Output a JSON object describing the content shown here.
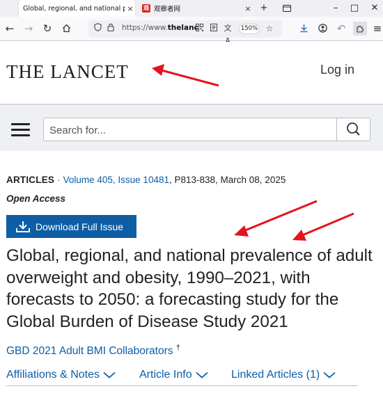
{
  "browser": {
    "tabs": [
      {
        "title": "Global, regional, and national pre",
        "active": true
      },
      {
        "title": "观察者网",
        "favicon": "观",
        "active": false
      }
    ],
    "controls": {
      "close_tab": "×",
      "new_tab": "+",
      "tab_list": "▭",
      "minimize": "–",
      "maximize": "□",
      "close_window": "✕"
    },
    "url": "https://www.thelancet",
    "url_bold_part": "thelanc",
    "url_prefix": "https://www.",
    "zoom": "150%"
  },
  "site": {
    "logo": "THE LANCET",
    "login": "Log in",
    "search_placeholder": "Search for..."
  },
  "article": {
    "type": "ARTICLES",
    "separator": "·",
    "volume_issue": "Volume 405, Issue 10481",
    "pages_date": ", P813-838, March 08, 2025",
    "access": "Open Access",
    "download_label": "Download Full Issue",
    "title": "Global, regional, and national prevalence of adult overweight and obesity, 1990–2021, with forecasts to 2050: a forecasting study for the Global Burden of Disease Study 2021",
    "authors": "GBD 2021 Adult BMI Collaborators",
    "authors_mark": "†",
    "tabs": [
      {
        "label": "Affiliations & Notes"
      },
      {
        "label": "Article Info"
      },
      {
        "label": "Linked Articles (1)"
      }
    ]
  },
  "colors": {
    "link": "#0b5ea8",
    "button": "#0e5ea5",
    "annotation_arrow": "#e4141c"
  }
}
